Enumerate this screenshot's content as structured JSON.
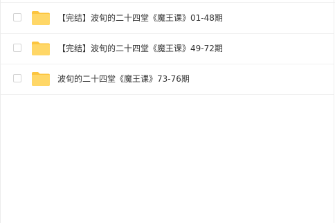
{
  "file_list": {
    "items": [
      {
        "name": "【完结】波旬的二十四堂《魔王课》01-48期",
        "type": "folder",
        "checked": false
      },
      {
        "name": "【完结】波旬的二十四堂《魔王课》49-72期",
        "type": "folder",
        "checked": false
      },
      {
        "name": "波旬的二十四堂《魔王课》73-76期",
        "type": "folder",
        "checked": false
      }
    ]
  },
  "icons": {
    "folder": "folder-icon",
    "checkbox": "checkbox-unchecked"
  },
  "colors": {
    "folder_fill": "#ffd767",
    "folder_tab": "#fcc53f",
    "text": "#333333",
    "divider": "#f0f0f0",
    "checkbox_border": "#d4d4d4"
  }
}
